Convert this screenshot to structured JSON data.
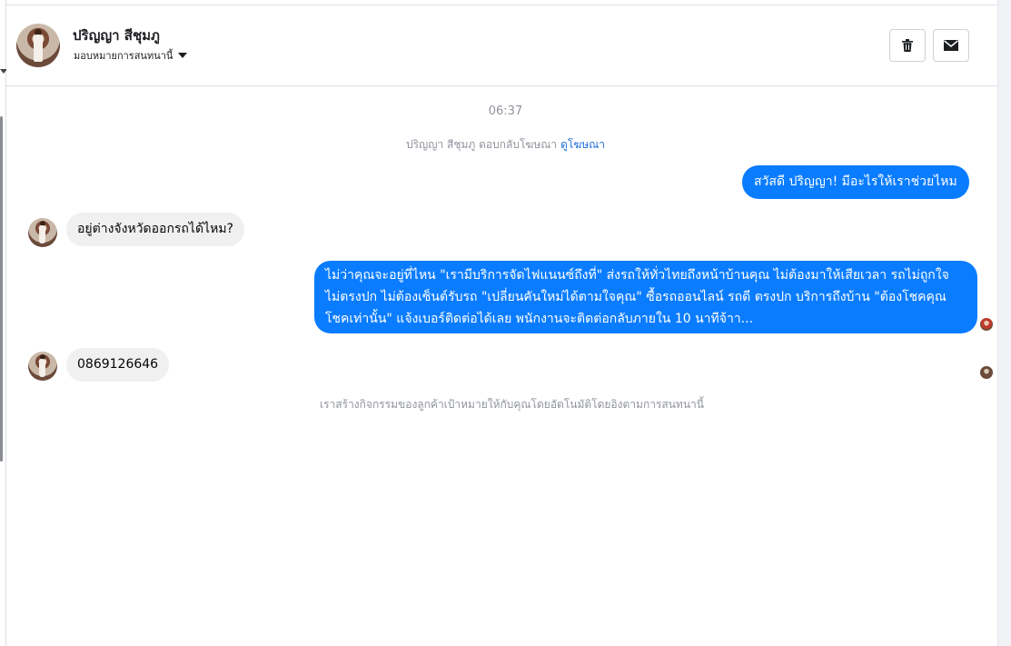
{
  "header": {
    "contact_name": "ปริญญา สีชุมภู",
    "assign_label": "มอบหมายการสนทนานี้",
    "trash_icon": "trash-icon",
    "mail_icon": "envelope-icon"
  },
  "conversation": {
    "timestamp": "06:37",
    "reply_note": "ปริญญา สีชุมภู ตอบกลับโฆษณา",
    "reply_note_link": "ดูโฆษณา",
    "messages": [
      {
        "direction": "outgoing",
        "text": "สวัสดี ปริญญา! มีอะไรให้เราช่วยไหม"
      },
      {
        "direction": "incoming",
        "text": "อยู่ต่างจังหวัดออกรถได้ไหม?"
      },
      {
        "direction": "outgoing",
        "text": "ไม่ว่าคุณจะอยู่ที่ไหน \"เรามีบริการจัดไฟแนนซ์ถึงที่\"  ส่งรถให้ทั่วไทยถึงหน้าบ้านคุณ ไม่ต้องมาให้เสียเวลา รถไม่ถูกใจ ไม่ตรงปก ไม่ต้องเซ็นต์รับรถ \"เปลี่ยนคันใหม่ได้ตามใจคุณ\" ซื้อรถออนไลน์ รถดี ตรงปก บริการถึงบ้าน \"ต้องโชคคุณโชคเท่านั้น\" แจ้งเบอร์ติดต่อได้เลย พนักงานจะติดต่อกลับภายใน 10 นาทีจ้าา..."
      },
      {
        "direction": "incoming",
        "text": "0869126646"
      }
    ],
    "footer_note": "เราสร้างกิจกรรมของลูกค้าเป้าหมายให้กับคุณโดยอัตโนมัติโดยอิงตามการสนทนานี้"
  },
  "colors": {
    "outgoing_bubble": "#0a7cff",
    "incoming_bubble": "#f0f0f0",
    "link": "#216fdb",
    "meta_text": "#90949c"
  }
}
